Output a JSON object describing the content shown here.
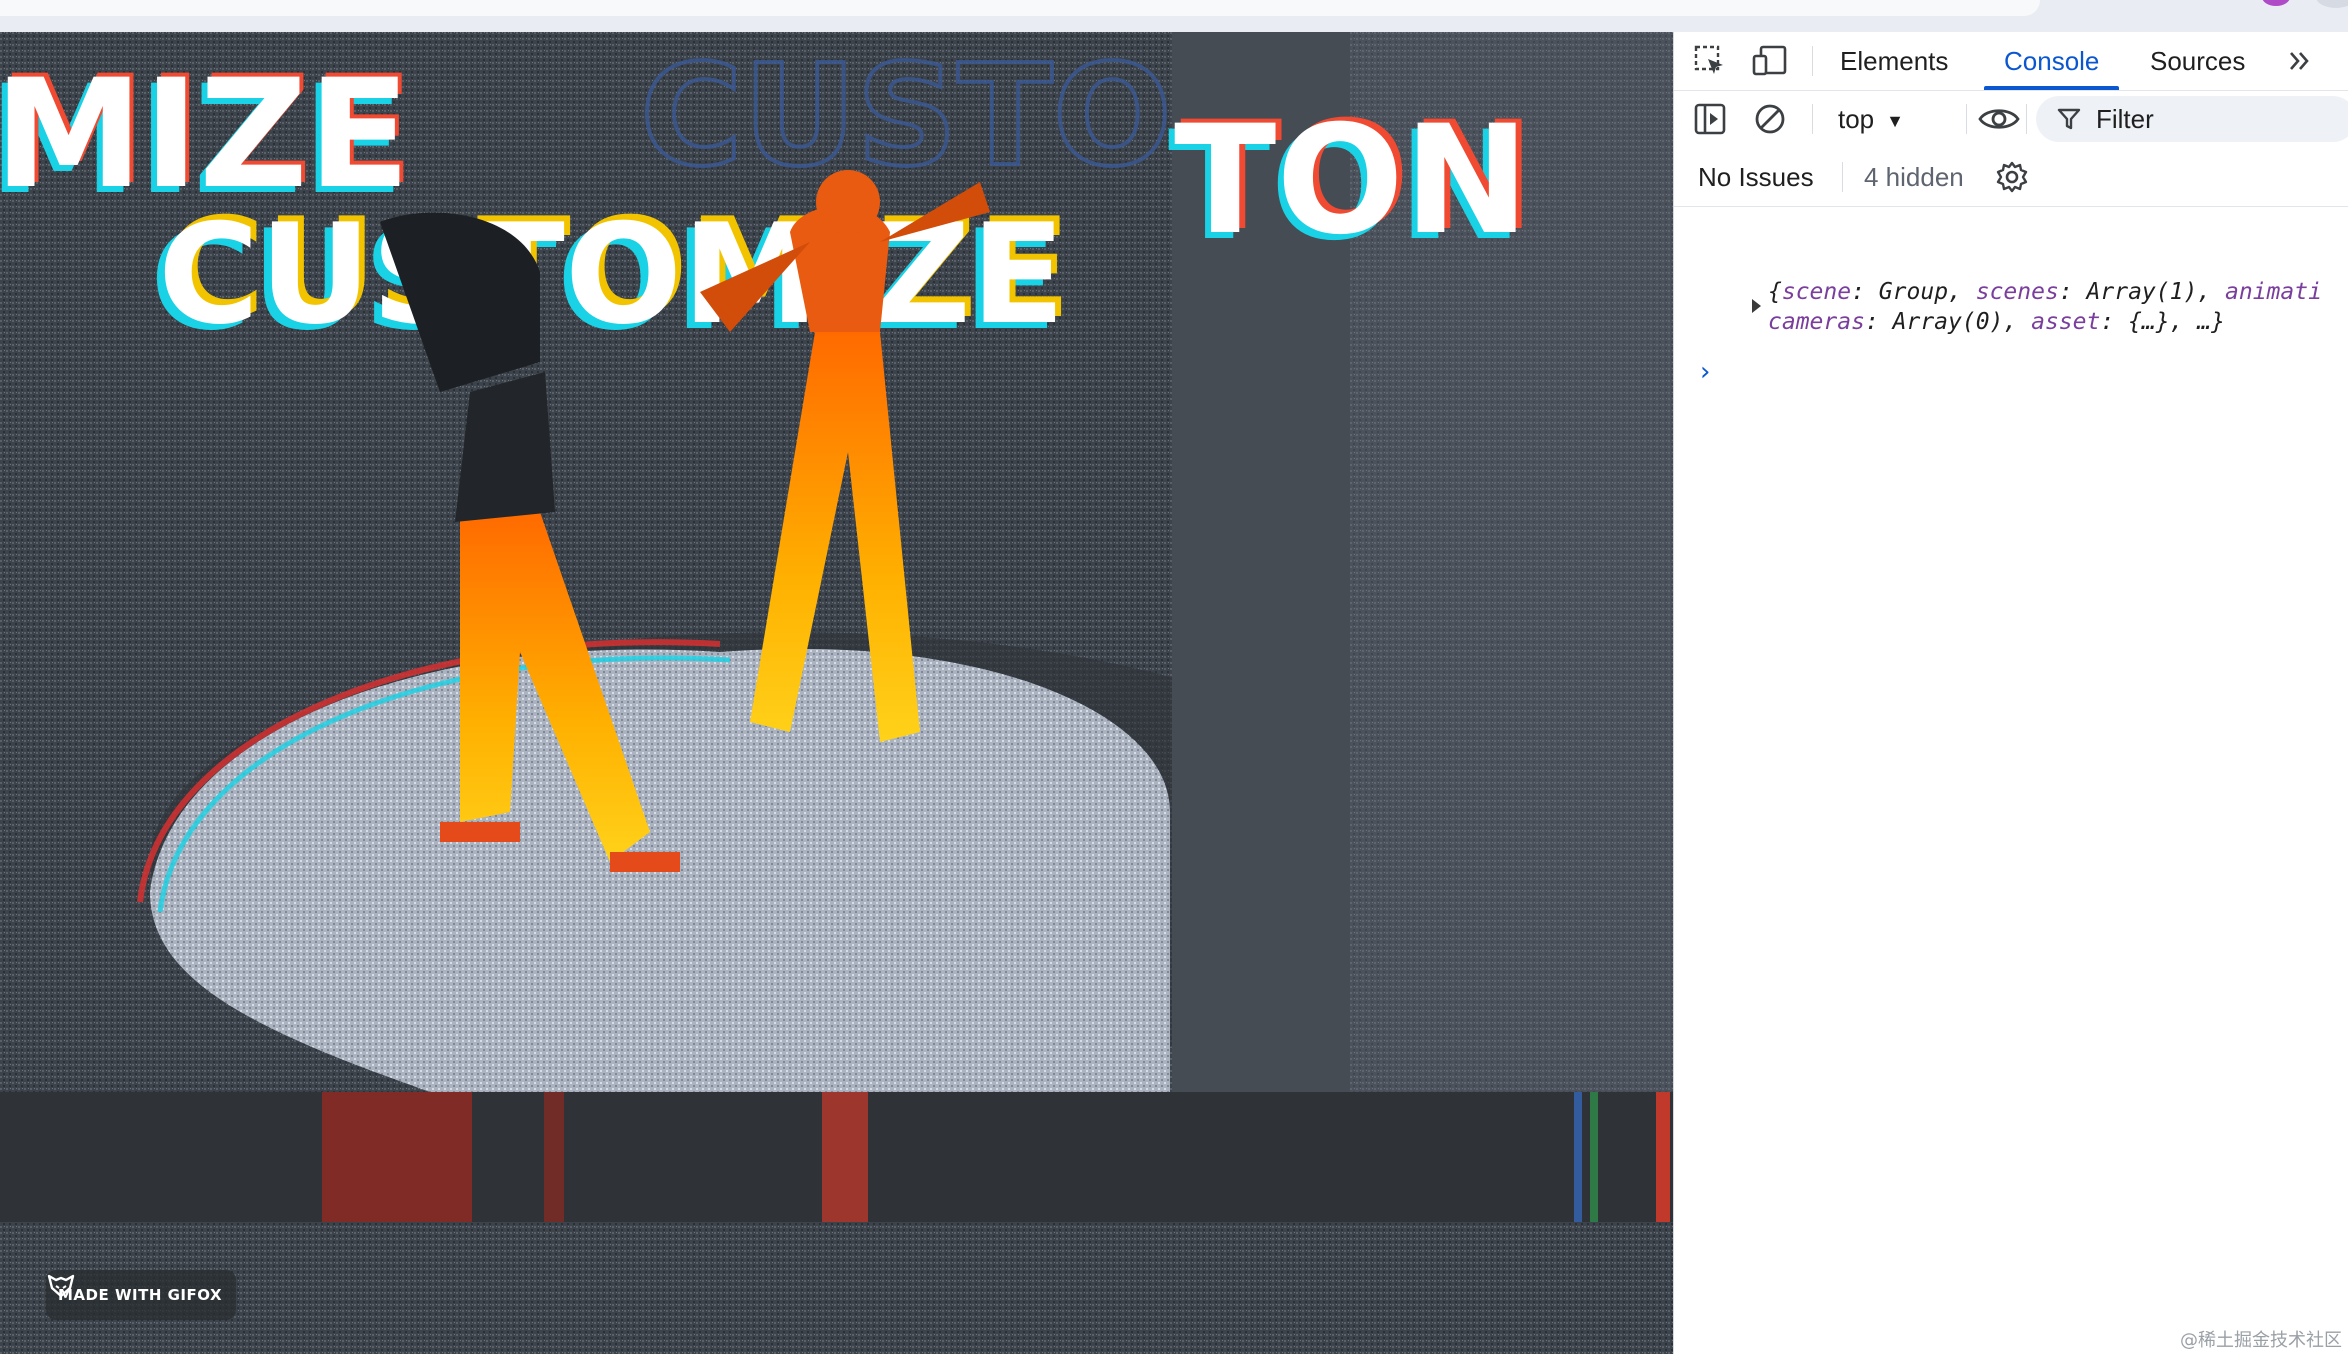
{
  "viewport": {
    "overlay_text_top": "MIZE",
    "overlay_text_mid": "CUSTOMIZE",
    "overlay_text_ghost": "CUSTO",
    "overlay_text_right": "TON",
    "gifox_badge": "MADE WITH GIFOX"
  },
  "devtools": {
    "tabs": [
      {
        "label": "Elements"
      },
      {
        "label": "Console"
      },
      {
        "label": "Sources"
      }
    ],
    "active_tab": "Console",
    "context_selector": "top",
    "filter_placeholder": "Filter",
    "issues": "No Issues",
    "hidden_count": "4 hidden",
    "console": {
      "log_part1_open": "{",
      "log_k1": "scene",
      "log_v1": ": Group, ",
      "log_k2": "scenes",
      "log_v2": ": Array(1), ",
      "log_k3": "animati",
      "log_k4": "cameras",
      "log_v4": ": Array(0), ",
      "log_k5": "asset",
      "log_v5": ": {…}, …}",
      "prompt_symbol": "›"
    }
  },
  "watermark": "@稀土掘金技术社区",
  "colors": {
    "accent": "#0b57d0",
    "console_key": "#7a3e9d"
  }
}
